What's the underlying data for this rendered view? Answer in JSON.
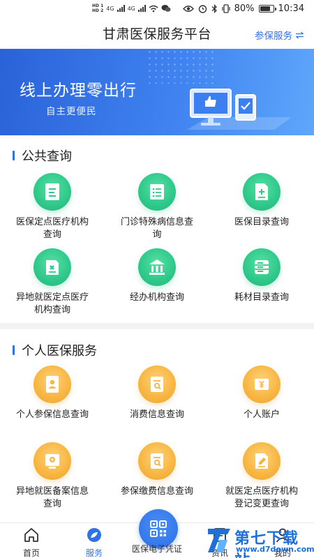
{
  "status_bar": {
    "hd1": "HD 1",
    "hd2": "HD 2",
    "net1": "4G",
    "net2": "4G",
    "battery": "80%",
    "time": "10:34"
  },
  "header": {
    "title": "甘肃医保服务平台",
    "insure_link": "参保服务",
    "insure_icon": "switch-arrows-icon"
  },
  "banner": {
    "title": "线上办理零出行",
    "subtitle": "自主更便民"
  },
  "public_query": {
    "title": "公共查询",
    "items": [
      {
        "label": "医保定点医疗机构查询",
        "icon": "document-icon"
      },
      {
        "label": "门诊特殊病信息查询",
        "icon": "list-icon"
      },
      {
        "label": "医保目录查询",
        "icon": "document-plus-icon"
      },
      {
        "label": "异地就医定点医疗机构查询",
        "icon": "medical-card-icon"
      },
      {
        "label": "经办机构查询",
        "icon": "building-icon"
      },
      {
        "label": "耗材目录查询",
        "icon": "storage-icon"
      }
    ]
  },
  "personal_service": {
    "title": "个人医保服务",
    "items": [
      {
        "label": "个人参保信息查询",
        "icon": "id-card-icon"
      },
      {
        "label": "消费信息查询",
        "icon": "search-document-icon"
      },
      {
        "label": "个人账户",
        "icon": "yuan-icon"
      },
      {
        "label": "异地就医备案信息查询",
        "icon": "location-icon"
      },
      {
        "label": "参保缴费信息查询",
        "icon": "search-document-icon"
      },
      {
        "label": "就医定点医疗机构登记变更查询",
        "icon": "edit-document-icon"
      }
    ]
  },
  "bottom_nav": {
    "home": "首页",
    "service": "服务",
    "voucher": "医保电子凭证",
    "news": "资讯",
    "mine": "我的"
  },
  "watermark": {
    "text": "第七下载站",
    "url": "www.d7down.com"
  },
  "colors": {
    "accent": "#2f72e8",
    "green": "#2ec88a",
    "orange": "#f7b540"
  }
}
